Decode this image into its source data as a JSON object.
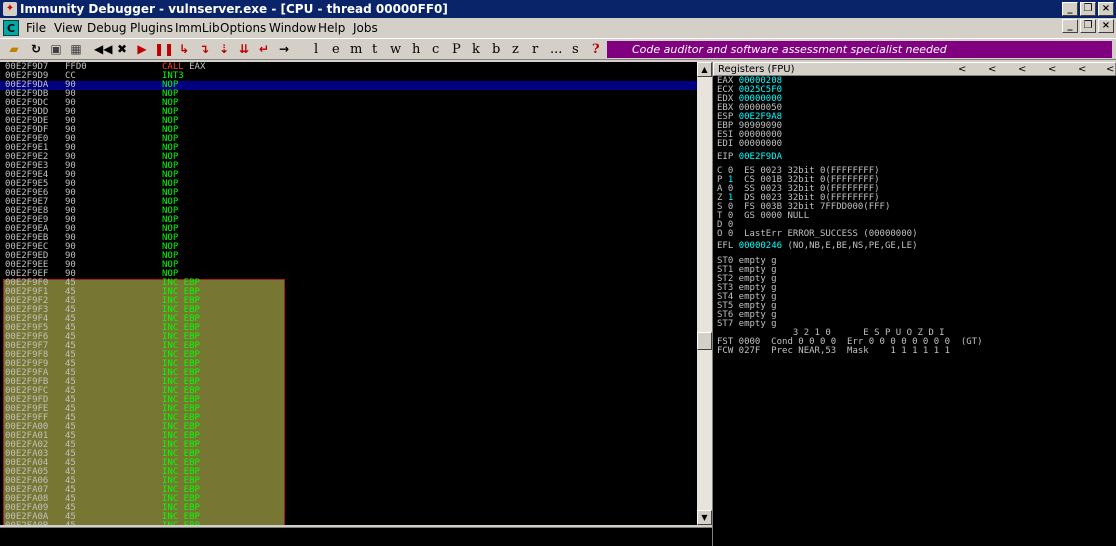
{
  "title": "Immunity Debugger - vulnserver.exe - [CPU - thread 00000FF0]",
  "menu": [
    "File",
    "View",
    "Debug",
    "Plugins",
    "ImmLib",
    "Options",
    "Window",
    "Help",
    "Jobs"
  ],
  "toolbar_letters": [
    "l",
    "e",
    "m",
    "t",
    "w",
    "h",
    "c",
    "P",
    "k",
    "b",
    "z",
    "r",
    "...",
    "s",
    "?"
  ],
  "banner": "Code auditor and software assessment specialist needed",
  "disasm": [
    [
      "00E2F9D7",
      "FFD0",
      "CALL EAX"
    ],
    [
      "00E2F9D9",
      "CC",
      "INT3"
    ],
    [
      "00E2F9DA",
      "90",
      "NOP"
    ],
    [
      "00E2F9DB",
      "90",
      "NOP"
    ],
    [
      "00E2F9DC",
      "90",
      "NOP"
    ],
    [
      "00E2F9DD",
      "90",
      "NOP"
    ],
    [
      "00E2F9DE",
      "90",
      "NOP"
    ],
    [
      "00E2F9DF",
      "90",
      "NOP"
    ],
    [
      "00E2F9E0",
      "90",
      "NOP"
    ],
    [
      "00E2F9E1",
      "90",
      "NOP"
    ],
    [
      "00E2F9E2",
      "90",
      "NOP"
    ],
    [
      "00E2F9E3",
      "90",
      "NOP"
    ],
    [
      "00E2F9E4",
      "90",
      "NOP"
    ],
    [
      "00E2F9E5",
      "90",
      "NOP"
    ],
    [
      "00E2F9E6",
      "90",
      "NOP"
    ],
    [
      "00E2F9E7",
      "90",
      "NOP"
    ],
    [
      "00E2F9E8",
      "90",
      "NOP"
    ],
    [
      "00E2F9E9",
      "90",
      "NOP"
    ],
    [
      "00E2F9EA",
      "90",
      "NOP"
    ],
    [
      "00E2F9EB",
      "90",
      "NOP"
    ],
    [
      "00E2F9EC",
      "90",
      "NOP"
    ],
    [
      "00E2F9ED",
      "90",
      "NOP"
    ],
    [
      "00E2F9EE",
      "90",
      "NOP"
    ],
    [
      "00E2F9EF",
      "90",
      "NOP"
    ],
    [
      "00E2F9F0",
      "45",
      "INC EBP"
    ],
    [
      "00E2F9F1",
      "45",
      "INC EBP"
    ],
    [
      "00E2F9F2",
      "45",
      "INC EBP"
    ],
    [
      "00E2F9F3",
      "45",
      "INC EBP"
    ],
    [
      "00E2F9F4",
      "45",
      "INC EBP"
    ],
    [
      "00E2F9F5",
      "45",
      "INC EBP"
    ],
    [
      "00E2F9F6",
      "45",
      "INC EBP"
    ],
    [
      "00E2F9F7",
      "45",
      "INC EBP"
    ],
    [
      "00E2F9F8",
      "45",
      "INC EBP"
    ],
    [
      "00E2F9F9",
      "45",
      "INC EBP"
    ],
    [
      "00E2F9FA",
      "45",
      "INC EBP"
    ],
    [
      "00E2F9FB",
      "45",
      "INC EBP"
    ],
    [
      "00E2F9FC",
      "45",
      "INC EBP"
    ],
    [
      "00E2F9FD",
      "45",
      "INC EBP"
    ],
    [
      "00E2F9FE",
      "45",
      "INC EBP"
    ],
    [
      "00E2F9FF",
      "45",
      "INC EBP"
    ],
    [
      "00E2FA00",
      "45",
      "INC EBP"
    ],
    [
      "00E2FA01",
      "45",
      "INC EBP"
    ],
    [
      "00E2FA02",
      "45",
      "INC EBP"
    ],
    [
      "00E2FA03",
      "45",
      "INC EBP"
    ],
    [
      "00E2FA04",
      "45",
      "INC EBP"
    ],
    [
      "00E2FA05",
      "45",
      "INC EBP"
    ],
    [
      "00E2FA06",
      "45",
      "INC EBP"
    ],
    [
      "00E2FA07",
      "45",
      "INC EBP"
    ],
    [
      "00E2FA08",
      "45",
      "INC EBP"
    ],
    [
      "00E2FA09",
      "45",
      "INC EBP"
    ],
    [
      "00E2FA0A",
      "45",
      "INC EBP"
    ],
    [
      "00E2FA0B",
      "45",
      "INC EBP"
    ]
  ],
  "registers": {
    "header": "Registers (FPU)",
    "gp": [
      [
        "EAX",
        "00000208",
        true
      ],
      [
        "ECX",
        "0025C5F0",
        true
      ],
      [
        "EDX",
        "00000000",
        true
      ],
      [
        "EBX",
        "00000050",
        false
      ],
      [
        "ESP",
        "00E2F9A8",
        true
      ],
      [
        "EBP",
        "90909090",
        false
      ],
      [
        "ESI",
        "00000000",
        false
      ],
      [
        "EDI",
        "00000000",
        false
      ]
    ],
    "eip": [
      "EIP",
      "00E2F9DA"
    ],
    "flags": [
      "C 0  ES 0023 32bit 0(FFFFFFFF)",
      "P 1  CS 001B 32bit 0(FFFFFFFF)",
      "A 0  SS 0023 32bit 0(FFFFFFFF)",
      "Z 1  DS 0023 32bit 0(FFFFFFFF)",
      "S 0  FS 003B 32bit 7FFDD000(FFF)",
      "T 0  GS 0000 NULL",
      "D 0",
      "O 0  LastErr ERROR_SUCCESS (00000000)"
    ],
    "efl": [
      "EFL",
      "00000246",
      "(NO,NB,E,BE,NS,PE,GE,LE)"
    ],
    "fpu": [
      "ST0 empty g",
      "ST1 empty g",
      "ST2 empty g",
      "ST3 empty g",
      "ST4 empty g",
      "ST5 empty g",
      "ST6 empty g",
      "ST7 empty g"
    ],
    "fst_head": "              3 2 1 0      E S P U O Z D I",
    "fst": "FST 0000  Cond 0 0 0 0  Err 0 0 0 0 0 0 0 0  (GT)",
    "fcw": "FCW 027F  Prec NEAR,53  Mask    1 1 1 1 1 1"
  },
  "colors": {
    "title_bg": "#0a246a",
    "banner_bg": "#800080",
    "mnemonic": "#00ff00",
    "call": "#ff4040",
    "reg_changed": "#00ffff",
    "selected_row": "#000080"
  }
}
